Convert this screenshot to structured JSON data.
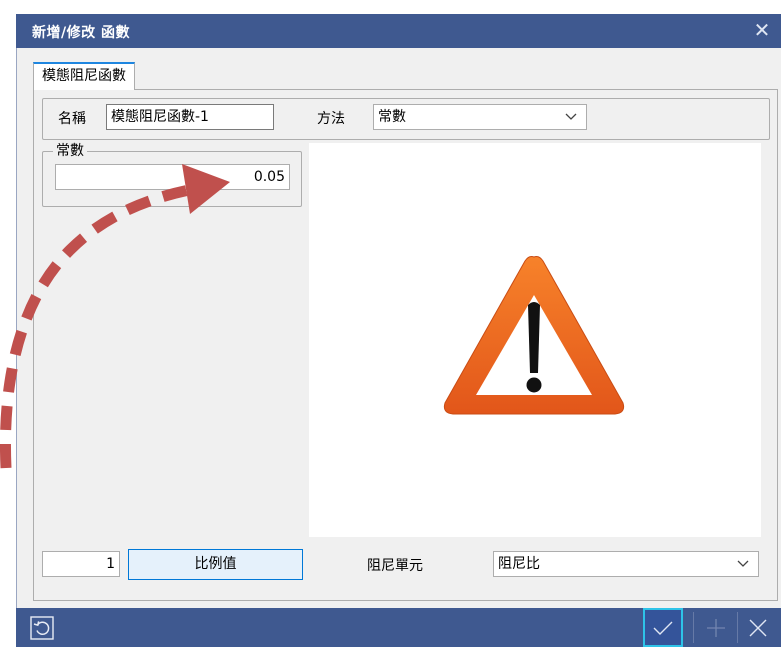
{
  "window": {
    "title": "新增/修改 函數"
  },
  "tabs": [
    {
      "label": "模態阻尼函數",
      "active": true
    }
  ],
  "form": {
    "name_label": "名稱",
    "name_value": "模態阻尼函數-1",
    "method_label": "方法",
    "method_value": "常數",
    "constant_legend": "常數",
    "constant_value": "0.05"
  },
  "bottom": {
    "scale_value": "1",
    "scale_button_label": "比例值",
    "damping_unit_label": "阻尼單元",
    "damping_unit_value": "阻尼比"
  },
  "footer": {
    "reset_icon": "reset-icon",
    "ok_icon": "check-icon",
    "add_icon": "plus-icon",
    "cancel_icon": "close-icon"
  },
  "colors": {
    "titlebar": "#3f5990",
    "warning_orange": "#f26a1b",
    "annotation_arrow": "#c0504d",
    "accent_blue": "#0078d7"
  }
}
